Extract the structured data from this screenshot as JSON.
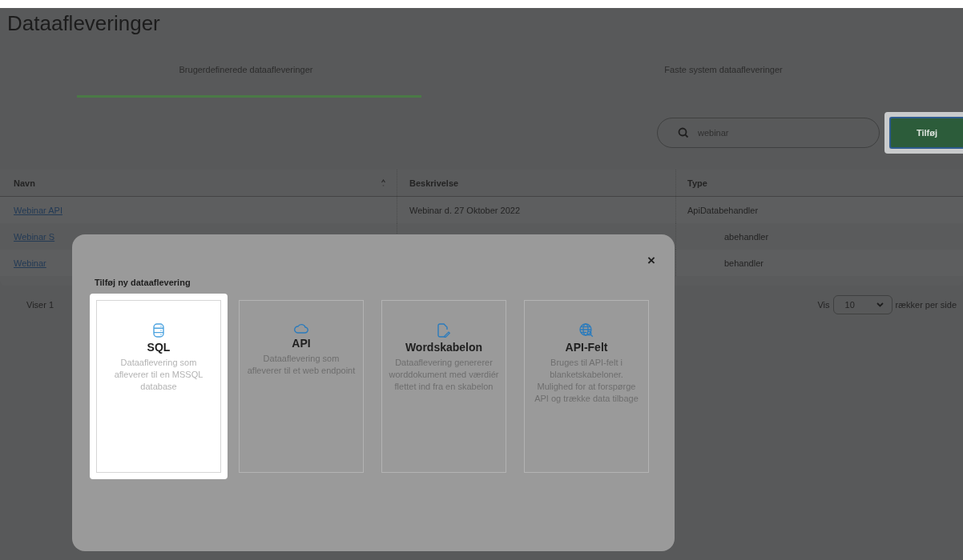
{
  "page": {
    "title": "Dataafleveringer"
  },
  "tabs": [
    {
      "label": "Brugerdefinerede dataafleveringer",
      "selected": true
    },
    {
      "label": "Faste system dataafleveringer",
      "selected": false
    }
  ],
  "search": {
    "value": "webinar"
  },
  "add_button": {
    "label": "Tilføj",
    "highlighted": true
  },
  "table": {
    "columns": [
      "Navn",
      "Beskrivelse",
      "Type"
    ],
    "rows": [
      {
        "name": "Webinar API",
        "description": "Webinar d. 27 Oktober 2022",
        "type": "ApiDatabehandler"
      },
      {
        "name": "Webinar S",
        "type": "abehandler"
      },
      {
        "name": "Webinar",
        "type": "behandler"
      }
    ]
  },
  "footer": {
    "showing": "Viser 1",
    "show_label": "Vis",
    "page_size": "10",
    "per_page_label": "rækker per side"
  },
  "dialog": {
    "close": "×",
    "title": "Tilføj ny dataaflevering",
    "cards": [
      {
        "kind": "database",
        "title": "SQL",
        "description": "Dataaflevering som afleverer til en MSSQL database",
        "selected": true
      },
      {
        "kind": "cloud",
        "title": "API",
        "description": "Dataaflevering som afleverer til et web endpoint",
        "selected": false
      },
      {
        "kind": "document",
        "title": "Wordskabelon",
        "description": "Dataaflevering genererer worddokument med værdiér flettet ind fra en skabelon",
        "selected": false
      },
      {
        "kind": "globe",
        "title": "API-Felt",
        "description": "Bruges til API-felt i blanketskabeloner. Mulighed for at forspørge API og trække data tilbage",
        "selected": false
      }
    ]
  }
}
